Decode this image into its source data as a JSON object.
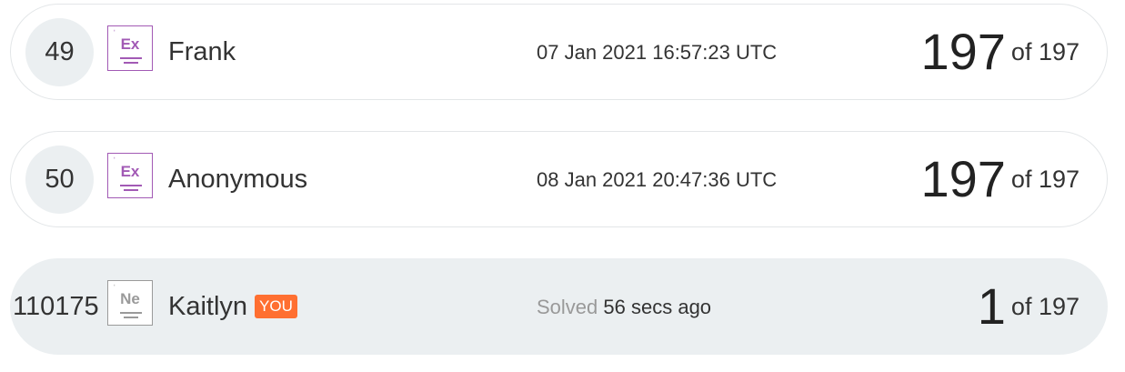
{
  "leaderboard": {
    "rows": [
      {
        "rank": "49",
        "badge": "Ex",
        "name": "Frank",
        "date": "07 Jan 2021 16:57:23 UTC",
        "score": "197",
        "of_total": "of 197"
      },
      {
        "rank": "50",
        "badge": "Ex",
        "name": "Anonymous",
        "date": "08 Jan 2021 20:47:36 UTC",
        "score": "197",
        "of_total": "of 197"
      },
      {
        "rank": "110175",
        "badge": "Ne",
        "name": "Kaitlyn",
        "you_label": "YOU",
        "solved_label": "Solved",
        "solved_ago": "56 secs ago",
        "score": "1",
        "of_total": "of 197"
      }
    ]
  },
  "colors": {
    "expert_badge": "#a25ab5",
    "novice_badge": "#9a9a9a",
    "you_badge": "#ff6f31",
    "current_row_bg": "#ebeff1"
  }
}
